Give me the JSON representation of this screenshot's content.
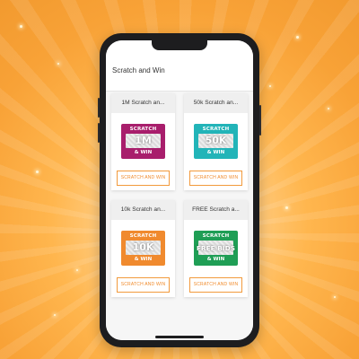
{
  "screen": {
    "title": "Scratch and Win"
  },
  "cards": [
    {
      "title": "1M Scratch an...",
      "ticket": {
        "top": "SCRATCH",
        "amount": "1M",
        "bottom": "& WIN",
        "color": "#a81e6c"
      },
      "button": "SCRATCH AND WIN"
    },
    {
      "title": "50k Scratch an...",
      "ticket": {
        "top": "SCRATCH",
        "amount": "50K",
        "bottom": "& WIN",
        "color": "#22b4b8"
      },
      "button": "SCRATCH AND WIN"
    },
    {
      "title": "10k Scratch an...",
      "ticket": {
        "top": "SCRATCH",
        "amount": "10K",
        "bottom": "& WIN",
        "color": "#f08a2e"
      },
      "button": "SCRATCH AND WIN"
    },
    {
      "title": "FREE Scratch a...",
      "ticket": {
        "top": "SCRATCH",
        "amount": "FREE BIDS",
        "bottom": "& WIN",
        "color": "#1f9e55"
      },
      "button": "SCRATCH AND WIN"
    }
  ],
  "colors": {
    "accent": "#f08a2a",
    "background": "#ffb64e"
  }
}
